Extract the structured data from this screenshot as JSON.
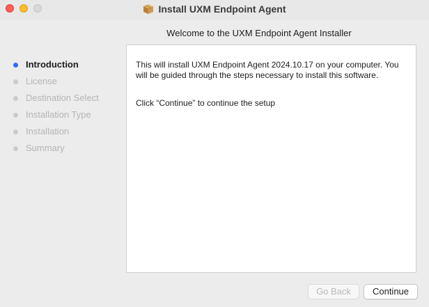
{
  "window": {
    "title": "Install UXM Endpoint Agent",
    "title_icon": "package-icon"
  },
  "header": {
    "title": "Welcome to the UXM Endpoint Agent Installer"
  },
  "sidebar": {
    "steps": [
      {
        "label": "Introduction",
        "active": true
      },
      {
        "label": "License",
        "active": false
      },
      {
        "label": "Destination Select",
        "active": false
      },
      {
        "label": "Installation Type",
        "active": false
      },
      {
        "label": "Installation",
        "active": false
      },
      {
        "label": "Summary",
        "active": false
      }
    ]
  },
  "content": {
    "paragraph1": "This will install UXM Endpoint Agent 2024.10.17 on your computer. You will be guided through the steps necessary to install this software.",
    "paragraph2": "Click “Continue” to continue the setup"
  },
  "buttons": {
    "back_label": "Go Back",
    "back_enabled": false,
    "continue_label": "Continue"
  },
  "colors": {
    "active_step": "#2f6cf5",
    "close": "#fe5f57",
    "minimize": "#febc2e",
    "zoom_disabled": "#d9d9d9"
  }
}
